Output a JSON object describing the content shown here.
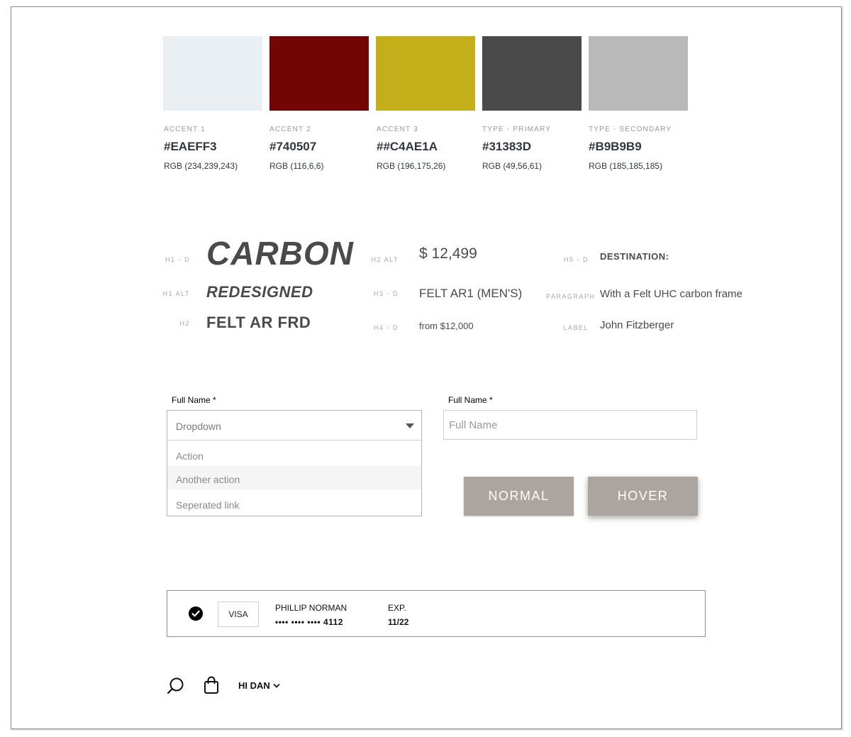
{
  "swatches": [
    {
      "caption": "ACCENT 1",
      "hex": "#EAEFF3",
      "rgb": "RGB (234,239,243)",
      "color": "#EAEFF3"
    },
    {
      "caption": "ACCENT 2",
      "hex": "#740507",
      "rgb": "RGB (116,6,6)",
      "color": "#740507"
    },
    {
      "caption": "ACCENT 3",
      "hex": "##C4AE1A",
      "rgb": "RGB (196,175,26)",
      "color": "#C4AE1A"
    },
    {
      "caption": "TYPE - PRIMARY",
      "hex": "#31383D",
      "rgb": "RGB (49,56,61)",
      "color": "#4A4A4A"
    },
    {
      "caption": "TYPE - SECONDARY",
      "hex": "#B9B9B9",
      "rgb": "RGB (185,185,185)",
      "color": "#B9B9B9"
    }
  ],
  "typography": {
    "h1": {
      "tag": "H1 - D",
      "text": "CARBON"
    },
    "h1_alt": {
      "tag": "H1 ALT",
      "text": "REDESIGNED"
    },
    "h2": {
      "tag": "H2",
      "text": "FELT AR FRD"
    },
    "h2_alt": {
      "tag": "H2 ALT",
      "text": "$ 12,499"
    },
    "h3": {
      "tag": "H3 - D",
      "text": "FELT AR1 (MEN'S)"
    },
    "h4": {
      "tag": "H4 - D",
      "text": "from $12,000"
    },
    "h5": {
      "tag": "H5 - D",
      "text": "DESTINATION:"
    },
    "paragraph": {
      "tag": "PARAGRAPH",
      "text": "With a Felt UHC carbon frame"
    },
    "label": {
      "tag": "LABEL",
      "text": "John Fitzberger"
    }
  },
  "form": {
    "dropdown_label": "Full Name *",
    "dropdown_value": "Dropdown",
    "dropdown_options": [
      "Action",
      "Another action",
      "Seperated link"
    ],
    "input_label": "Full Name *",
    "input_placeholder": "Full Name",
    "input_value": ""
  },
  "buttons": {
    "normal": "NORMAL",
    "hover": "HOVER",
    "color": "#ACA49F"
  },
  "payment_card": {
    "brand": "VISA",
    "holder": "PHILLIP NORMAN",
    "masked_prefix": "•••• •••• ••••",
    "last4": "4112",
    "exp_label": "EXP.",
    "exp": "11/22",
    "selected_icon": "check-circle-icon"
  },
  "nav": {
    "search_icon": "search-icon",
    "bag_icon": "shopping-bag-icon",
    "greeting": "HI DAN",
    "chevron_icon": "chevron-down-icon"
  }
}
